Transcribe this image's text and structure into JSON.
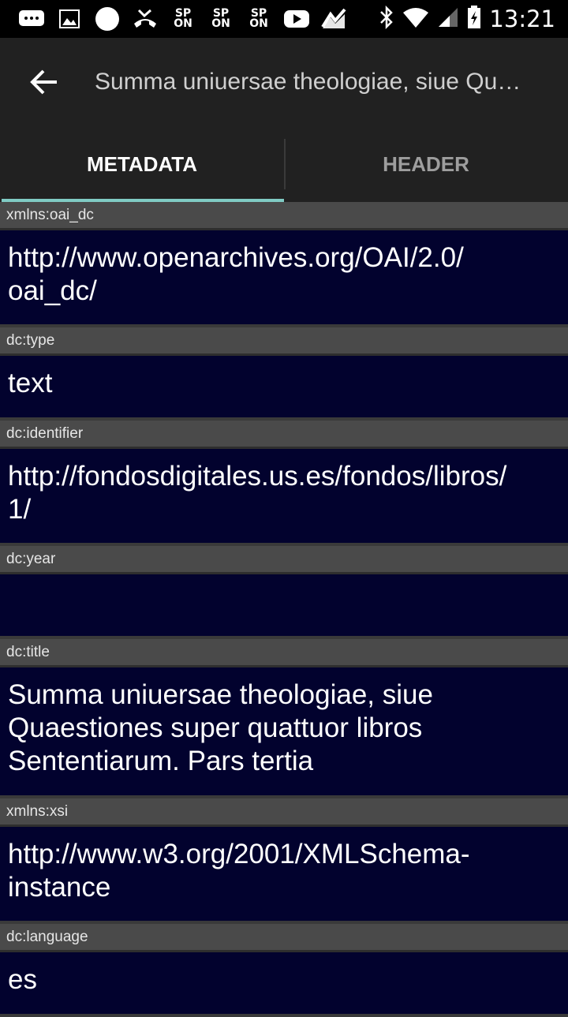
{
  "status_bar": {
    "sp_badges": [
      {
        "top": "SP",
        "bottom": "ON"
      },
      {
        "top": "SP",
        "bottom": "ON"
      },
      {
        "top": "SP",
        "bottom": "ON"
      }
    ],
    "time": "13:21"
  },
  "app_bar": {
    "title": "Summa uniuersae theologiae, siue Qu…"
  },
  "tabs": [
    {
      "label": "METADATA",
      "active": true
    },
    {
      "label": "HEADER",
      "active": false
    }
  ],
  "colors": {
    "tab_indicator": "#80cbc4",
    "value_bg": "#02022e",
    "label_bg": "#4a4a4a"
  },
  "fields": [
    {
      "label": "xmlns:oai_dc",
      "value": "http://www.openarchives.org/OAI/2.0/\noai_dc/"
    },
    {
      "label": "dc:type",
      "value": "text"
    },
    {
      "label": "dc:identifier",
      "value": "http://fondosdigitales.us.es/fondos/libros/\n1/"
    },
    {
      "label": "dc:year",
      "value": ""
    },
    {
      "label": "dc:title",
      "value": "Summa uniuersae theologiae, siue Quaestiones super quattuor libros Sententiarum. Pars tertia"
    },
    {
      "label": "xmlns:xsi",
      "value": "http://www.w3.org/2001/XMLSchema-\ninstance"
    },
    {
      "label": "dc:language",
      "value": "es"
    }
  ]
}
